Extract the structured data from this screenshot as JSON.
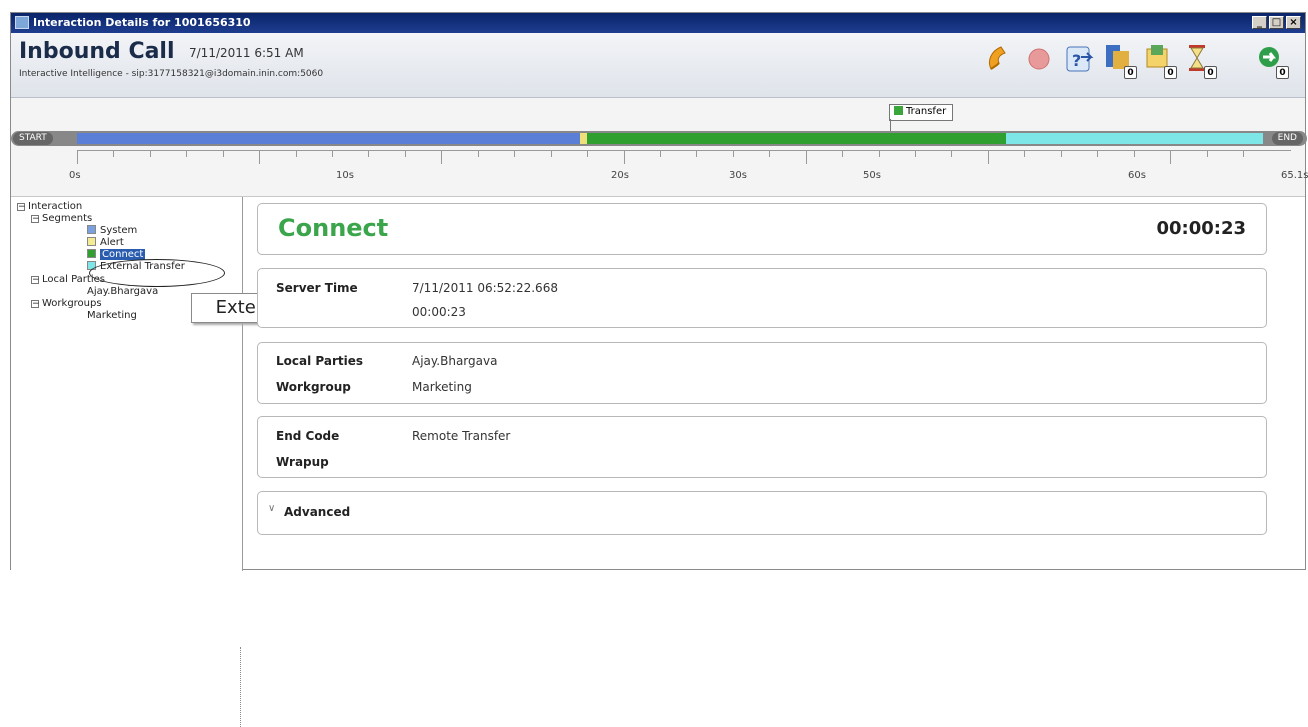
{
  "window": {
    "title": "Interaction Details for 1001656310"
  },
  "header": {
    "title": "Inbound Call",
    "datetime": "7/11/2011 6:51 AM",
    "subtitle": "Interactive Intelligence - sip:3177158321@i3domain.inin.com:5060"
  },
  "toolbar": [
    {
      "icon": "phone-icon",
      "badge": null
    },
    {
      "icon": "record-icon",
      "badge": null
    },
    {
      "icon": "help-transfer-icon",
      "badge": null
    },
    {
      "icon": "voicemail-icon",
      "badge": "0"
    },
    {
      "icon": "notes-icon",
      "badge": "0"
    },
    {
      "icon": "hourglass-icon",
      "badge": "0"
    },
    {
      "icon": "forward-arrow-icon",
      "badge": "0"
    }
  ],
  "timeline": {
    "start_label": "START",
    "end_label": "END",
    "event_label": "Transfer",
    "tick_labels": [
      "0s",
      "10s",
      "20s",
      "30s",
      "50s",
      "60s",
      "65.1s"
    ],
    "segments": [
      {
        "name": "System",
        "color": "#5b7ed6",
        "start_s": 0.0,
        "end_s": 27.6
      },
      {
        "name": "Alert",
        "color": "#ede07a",
        "start_s": 27.6,
        "end_s": 28.0
      },
      {
        "name": "Connect",
        "color": "#2fa02f",
        "start_s": 28.0,
        "end_s": 51.0
      },
      {
        "name": "External Transfer",
        "color": "#7ee6e6",
        "start_s": 51.0,
        "end_s": 65.1
      }
    ]
  },
  "tree": {
    "root": "Interaction",
    "segments_label": "Segments",
    "segments": [
      {
        "label": "System",
        "color": "#7ba0de"
      },
      {
        "label": "Alert",
        "color": "#f3ec94"
      },
      {
        "label": "Connect",
        "color": "#2fa02f"
      },
      {
        "label": "External Transfer",
        "color": "#7ee6e6"
      }
    ],
    "local_parties_label": "Local Parties",
    "local_party": "Ajay.Bhargava",
    "workgroups_label": "Workgroups",
    "workgroup": "Marketing",
    "tooltip": "External Transfer"
  },
  "detail": {
    "title": "Connect",
    "duration": "00:00:23",
    "server_time_label": "Server Time",
    "server_time": "7/11/2011 06:52:22.668",
    "duration_value": "00:00:23",
    "local_parties_label": "Local Parties",
    "local_parties": "Ajay.Bhargava",
    "workgroup_label": "Workgroup",
    "workgroup": "Marketing",
    "end_code_label": "End Code",
    "end_code": "Remote Transfer",
    "wrapup_label": "Wrapup",
    "advanced_label": "Advanced"
  }
}
